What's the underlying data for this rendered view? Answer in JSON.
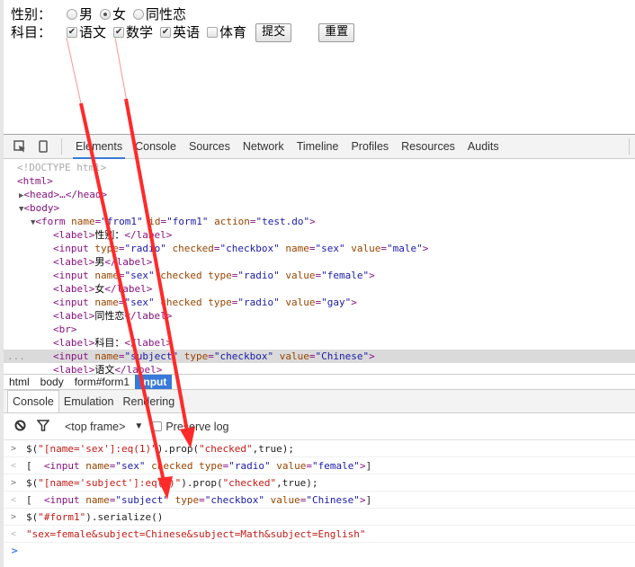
{
  "page": {
    "sex_label": "性别：",
    "sex_options": [
      {
        "label": "男",
        "checked": false
      },
      {
        "label": "女",
        "checked": true
      },
      {
        "label": "同性恋",
        "checked": false
      }
    ],
    "subject_label": "科目：",
    "subject_options": [
      {
        "label": "语文",
        "checked": true
      },
      {
        "label": "数学",
        "checked": true
      },
      {
        "label": "英语",
        "checked": true
      },
      {
        "label": "体育",
        "checked": false
      }
    ],
    "submit_label": "提交",
    "reset_label": "重置"
  },
  "devtools": {
    "tools": {
      "inspect_icon": "inspect-element-icon",
      "device_icon": "device-mode-icon"
    },
    "tabs": [
      "Elements",
      "Console",
      "Sources",
      "Network",
      "Timeline",
      "Profiles",
      "Resources",
      "Audits"
    ],
    "active_tab": "Elements",
    "dom": {
      "doctype": "<!DOCTYPE html>",
      "html_open": "<html>",
      "head": "<head>…</head>",
      "body_open": "<body>",
      "form_tag": "form",
      "form_attrs": [
        {
          "name": "name",
          "value": "from1"
        },
        {
          "name": "id",
          "value": "form1"
        },
        {
          "name": "action",
          "value": "test.do"
        }
      ],
      "lines": [
        {
          "type": "label",
          "text": "性别："
        },
        {
          "type": "input",
          "attrs": [
            [
              "type",
              "radio"
            ],
            [
              "checked",
              "checkbox"
            ],
            [
              "name",
              "sex"
            ],
            [
              "value",
              "male"
            ]
          ]
        },
        {
          "type": "label",
          "text": "男"
        },
        {
          "type": "input",
          "attrs": [
            [
              "name",
              "sex"
            ],
            [
              "checked",
              null
            ],
            [
              "type",
              "radio"
            ],
            [
              "value",
              "female"
            ]
          ]
        },
        {
          "type": "label",
          "text": "女"
        },
        {
          "type": "input",
          "attrs": [
            [
              "name",
              "sex"
            ],
            [
              "checked",
              null
            ],
            [
              "type",
              "radio"
            ],
            [
              "value",
              "gay"
            ]
          ]
        },
        {
          "type": "label",
          "text": "同性恋"
        },
        {
          "type": "br"
        },
        {
          "type": "label",
          "text": "科目："
        },
        {
          "type": "input",
          "attrs": [
            [
              "name",
              "subject"
            ],
            [
              "type",
              "checkbox"
            ],
            [
              "value",
              "Chinese"
            ]
          ],
          "selected": true
        },
        {
          "type": "label",
          "text": "语文"
        }
      ]
    },
    "breadcrumbs": [
      "html",
      "body",
      "form#form1",
      "input"
    ],
    "active_breadcrumb": "input",
    "drawer_tabs": [
      "Console",
      "Emulation",
      "Rendering"
    ],
    "active_drawer_tab": "Console",
    "console_toolbar": {
      "clear_icon": "clear-console-icon",
      "filter_icon": "filter-icon",
      "frame_selector": "<top frame>",
      "preserve_log_label": "Preserve log",
      "preserve_log_checked": false
    },
    "console": [
      {
        "kind": "input",
        "parts": [
          [
            "p",
            "$("
          ],
          [
            "s",
            "\"[name='sex']:eq(1)\""
          ],
          [
            "p",
            ").prop("
          ],
          [
            "s",
            "\"checked\""
          ],
          [
            "p",
            ",true);"
          ]
        ]
      },
      {
        "kind": "output",
        "parts": [
          [
            "p",
            "[  "
          ],
          [
            "tag",
            "<input "
          ],
          [
            "attr",
            "name"
          ],
          [
            "tag",
            "="
          ],
          [
            "val",
            "\"sex\""
          ],
          [
            "attr",
            " checked"
          ],
          [
            "attr",
            " type"
          ],
          [
            "tag",
            "="
          ],
          [
            "val",
            "\"radio\""
          ],
          [
            "attr",
            " value"
          ],
          [
            "tag",
            "="
          ],
          [
            "val",
            "\"female\""
          ],
          [
            "tag",
            ">"
          ],
          [
            "p",
            "]"
          ]
        ]
      },
      {
        "kind": "input",
        "parts": [
          [
            "p",
            "$("
          ],
          [
            "s",
            "\"[name='subject']:eq(0)\""
          ],
          [
            "p",
            ").prop("
          ],
          [
            "s",
            "\"checked\""
          ],
          [
            "p",
            ",true);"
          ]
        ]
      },
      {
        "kind": "output",
        "parts": [
          [
            "p",
            "[  "
          ],
          [
            "tag",
            "<input "
          ],
          [
            "attr",
            "name"
          ],
          [
            "tag",
            "="
          ],
          [
            "val",
            "\"subject\""
          ],
          [
            "attr",
            " type"
          ],
          [
            "tag",
            "="
          ],
          [
            "val",
            "\"checkbox\""
          ],
          [
            "attr",
            " value"
          ],
          [
            "tag",
            "="
          ],
          [
            "val",
            "\"Chinese\""
          ],
          [
            "tag",
            ">"
          ],
          [
            "p",
            "]"
          ]
        ]
      },
      {
        "kind": "input",
        "parts": [
          [
            "p",
            "$("
          ],
          [
            "s",
            "\"#form1\""
          ],
          [
            "p",
            ").serialize()"
          ]
        ]
      },
      {
        "kind": "output",
        "parts": [
          [
            "s",
            "\"sex=female&subject=Chinese&subject=Math&subject=English\""
          ]
        ]
      }
    ],
    "annotation_color": "#ff2a2a",
    "highlight_color": "#3879d9"
  }
}
